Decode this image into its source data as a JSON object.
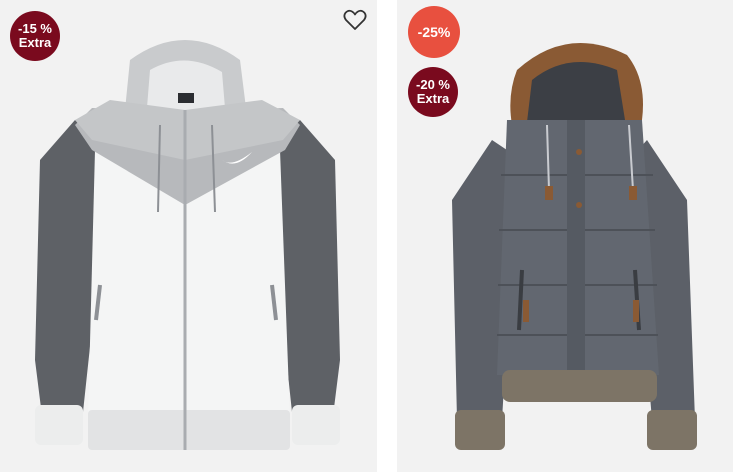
{
  "products": [
    {
      "image_alt": "",
      "badges": [
        {
          "line1": "-15 %",
          "line2": "Extra",
          "color": "#7a0a1e"
        }
      ],
      "wishlist_icon": "heart-outline-icon"
    },
    {
      "image_alt": "",
      "badges": [
        {
          "line1": "-25%",
          "color": "#e8503f"
        },
        {
          "line1": "-20 %",
          "line2": "Extra",
          "color": "#7a0a1e"
        }
      ]
    }
  ]
}
